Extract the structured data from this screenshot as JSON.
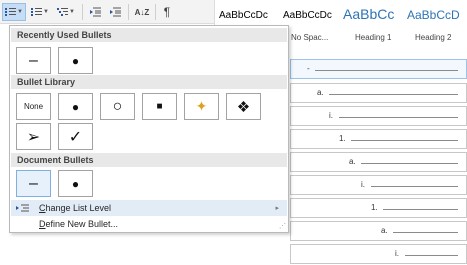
{
  "ribbon": {
    "bullets_icon": "bullets-icon",
    "numbering_icon": "numbering-icon",
    "multilevel_icon": "multilevel-list-icon",
    "decrease_indent_icon": "decrease-indent-icon",
    "increase_indent_icon": "increase-indent-icon",
    "sort_label": "A↓Z",
    "pilcrow": "¶"
  },
  "styles": [
    {
      "preview": "AaBbCcDc",
      "name": ""
    },
    {
      "preview": "AaBbCcDc",
      "name": "No Spac..."
    },
    {
      "preview": "AaBbCc",
      "name": "Heading 1"
    },
    {
      "preview": "AaBbCcD",
      "name": "Heading 2"
    }
  ],
  "menu": {
    "recently_used_title": "Recently Used Bullets",
    "recently_used": [
      "–",
      "●"
    ],
    "library_title": "Bullet Library",
    "library": [
      "None",
      "●",
      "○",
      "■",
      "✦",
      "❖",
      "➢",
      "✓"
    ],
    "document_title": "Document Bullets",
    "document": [
      "–",
      "●"
    ],
    "change_list_level": {
      "accel": "C",
      "rest": "hange List Level"
    },
    "define_new_bullet": {
      "accel": "D",
      "rest": "efine New Bullet..."
    },
    "change_level_arrow": "▸",
    "grip": "⋰"
  },
  "doc_levels": [
    "-",
    "a.",
    "i.",
    "1.",
    "a.",
    "i.",
    "1.",
    "a.",
    "i."
  ]
}
